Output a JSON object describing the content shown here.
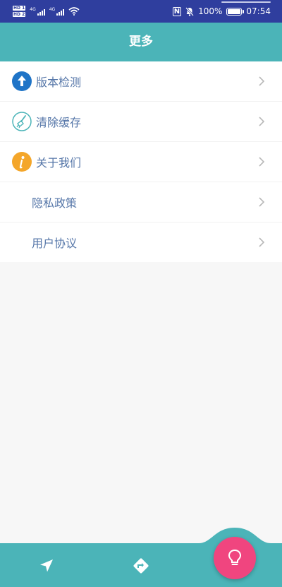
{
  "status_bar": {
    "hd1": "HD 1",
    "hd2": "HD 2",
    "net1": "4G",
    "net2": "4G",
    "battery": "100%",
    "time": "07:54",
    "icons": [
      "nfc-icon",
      "mute-icon",
      "wifi-icon",
      "battery-icon"
    ]
  },
  "header": {
    "title": "更多"
  },
  "menu": {
    "items": [
      {
        "label": "版本检测",
        "icon": "upload-arrow-icon"
      },
      {
        "label": "清除缓存",
        "icon": "broom-icon"
      },
      {
        "label": "关于我们",
        "icon": "info-icon"
      },
      {
        "label": "隐私政策"
      },
      {
        "label": "用户协议"
      }
    ]
  },
  "bottom_nav": {
    "items": [
      "location-arrow-icon",
      "directions-icon"
    ],
    "fab_icon": "lightbulb-icon"
  },
  "colors": {
    "status_bar": "#2f3e9e",
    "accent": "#4bb4b8",
    "fab": "#f0457f",
    "label": "#5576a8"
  }
}
